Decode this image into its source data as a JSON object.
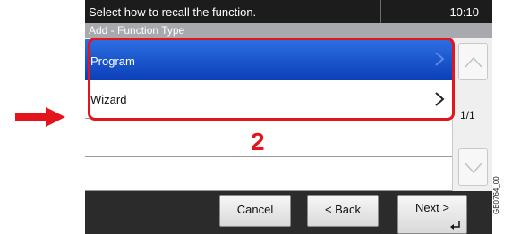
{
  "status_bar": {
    "message": "Select how to recall the function.",
    "time": "10:10"
  },
  "title_bar": {
    "title": "Add - Function Type"
  },
  "list": {
    "items": [
      {
        "label": "Program"
      },
      {
        "label": "Wizard"
      }
    ]
  },
  "pager": {
    "page": "1/1"
  },
  "callout": {
    "step_number": "2"
  },
  "bottom_bar": {
    "cancel_label": "Cancel",
    "back_label": "< Back",
    "next_label": "Next >"
  },
  "figure_code": "GB0764_00",
  "colors": {
    "selected_row": "#0a3fb8",
    "callout": "#e3141c",
    "indicator_arrow": "#e3141c"
  },
  "icons": {
    "row_chevron": "chevron-right-icon",
    "scroll_up": "arrow-up-icon",
    "scroll_down": "arrow-down-icon",
    "enter": "enter-icon"
  }
}
